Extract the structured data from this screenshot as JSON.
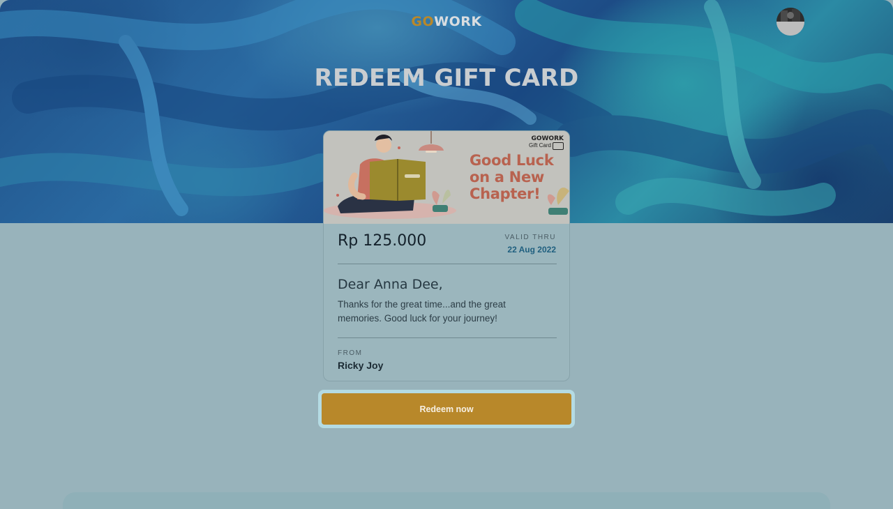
{
  "header": {
    "logo_prefix": "GO",
    "logo_suffix": "WORK",
    "avatar_icon": "user-avatar"
  },
  "page": {
    "title": "REDEEM GIFT CARD"
  },
  "gift_card": {
    "banner": {
      "brand_name": "GOWORK",
      "brand_sub": "Gift Card",
      "headline_line1": "Good Luck",
      "headline_line2": "on a New",
      "headline_line3": "Chapter!"
    },
    "amount": "Rp 125.000",
    "valid_label": "VALID THRU",
    "valid_date": "22 Aug 2022",
    "greeting": "Dear Anna Dee,",
    "message": "Thanks for the great time...and the great memories. Good luck for your journey!",
    "from_label": "FROM",
    "from_name": "Ricky Joy"
  },
  "actions": {
    "redeem_label": "Redeem now"
  },
  "colors": {
    "accent": "#b8882a",
    "banner_text": "#b8624f",
    "date_text": "#1f5f7f"
  }
}
